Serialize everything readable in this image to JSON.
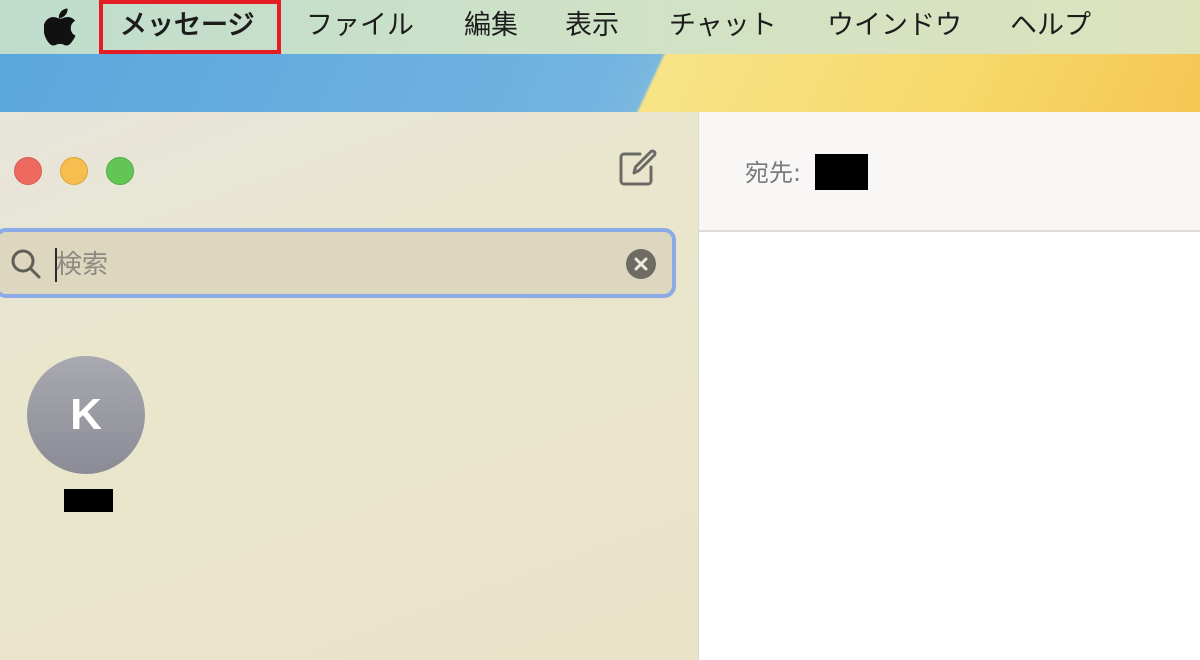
{
  "menubar": {
    "apple_icon": "apple-logo",
    "app_name": "メッセージ",
    "items": [
      "ファイル",
      "編集",
      "表示",
      "チャット",
      "ウインドウ",
      "ヘルプ"
    ],
    "highlight_color": "#e51c23"
  },
  "window": {
    "traffic_lights": {
      "close": "#ee6a5f",
      "minimize": "#f5be4f",
      "zoom": "#62c554"
    },
    "compose_icon": "compose-icon"
  },
  "search": {
    "placeholder": "検索",
    "focus_ring_color": "#8aabe5"
  },
  "conversations": [
    {
      "avatar_initial": "K",
      "name_redacted": true
    }
  ],
  "conversation_pane": {
    "to_label": "宛先:",
    "recipient_redacted": true
  }
}
